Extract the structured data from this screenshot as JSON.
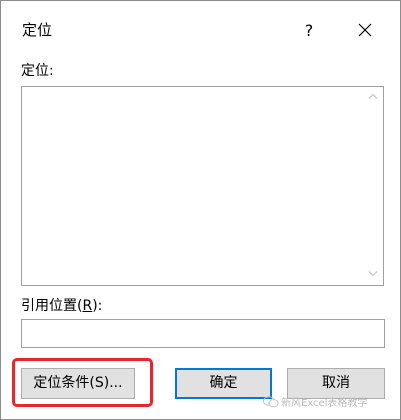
{
  "dialog": {
    "title": "定位",
    "help_label": "?",
    "goto_label": "定位:",
    "goto_items": [],
    "reference_label_prefix": "引用位置(",
    "reference_label_key": "R",
    "reference_label_suffix": "):",
    "reference_value": "",
    "buttons": {
      "special": "定位条件(S)...",
      "ok": "确定",
      "cancel": "取消"
    }
  },
  "watermark": {
    "text": "新风Excel表格教学"
  },
  "colors": {
    "highlight": "#e8262e",
    "default_button_border": "#0078d7",
    "button_face": "#e1e1e1"
  }
}
